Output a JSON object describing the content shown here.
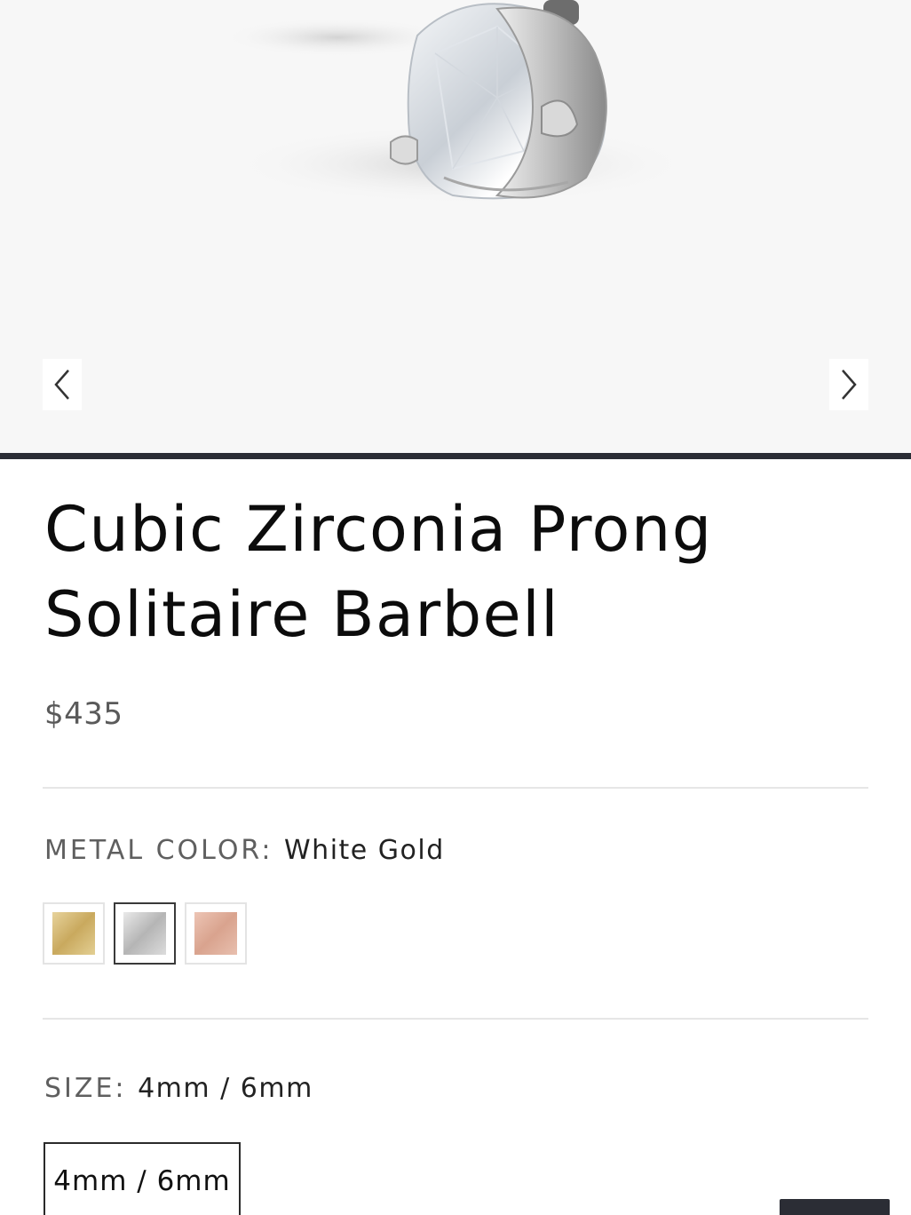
{
  "product": {
    "title": "Cubic Zirconia Prong Solitaire Barbell",
    "price": "$435"
  },
  "gallery": {
    "prev_icon": "chevron-left-icon",
    "next_icon": "chevron-right-icon"
  },
  "metal_color": {
    "label": "METAL COLOR:",
    "selected": "White Gold",
    "options": [
      {
        "name": "yellow-gold",
        "color": "#d8bf7e"
      },
      {
        "name": "white-gold",
        "color": "#c9c9c9"
      },
      {
        "name": "rose-gold",
        "color": "#e2b4a2"
      }
    ]
  },
  "size": {
    "label": "SIZE:",
    "selected": "4mm / 6mm",
    "options": [
      "4mm / 6mm"
    ]
  },
  "colors": {
    "accent": "#2b2d35",
    "gallery_bg": "#f7f7f7"
  }
}
